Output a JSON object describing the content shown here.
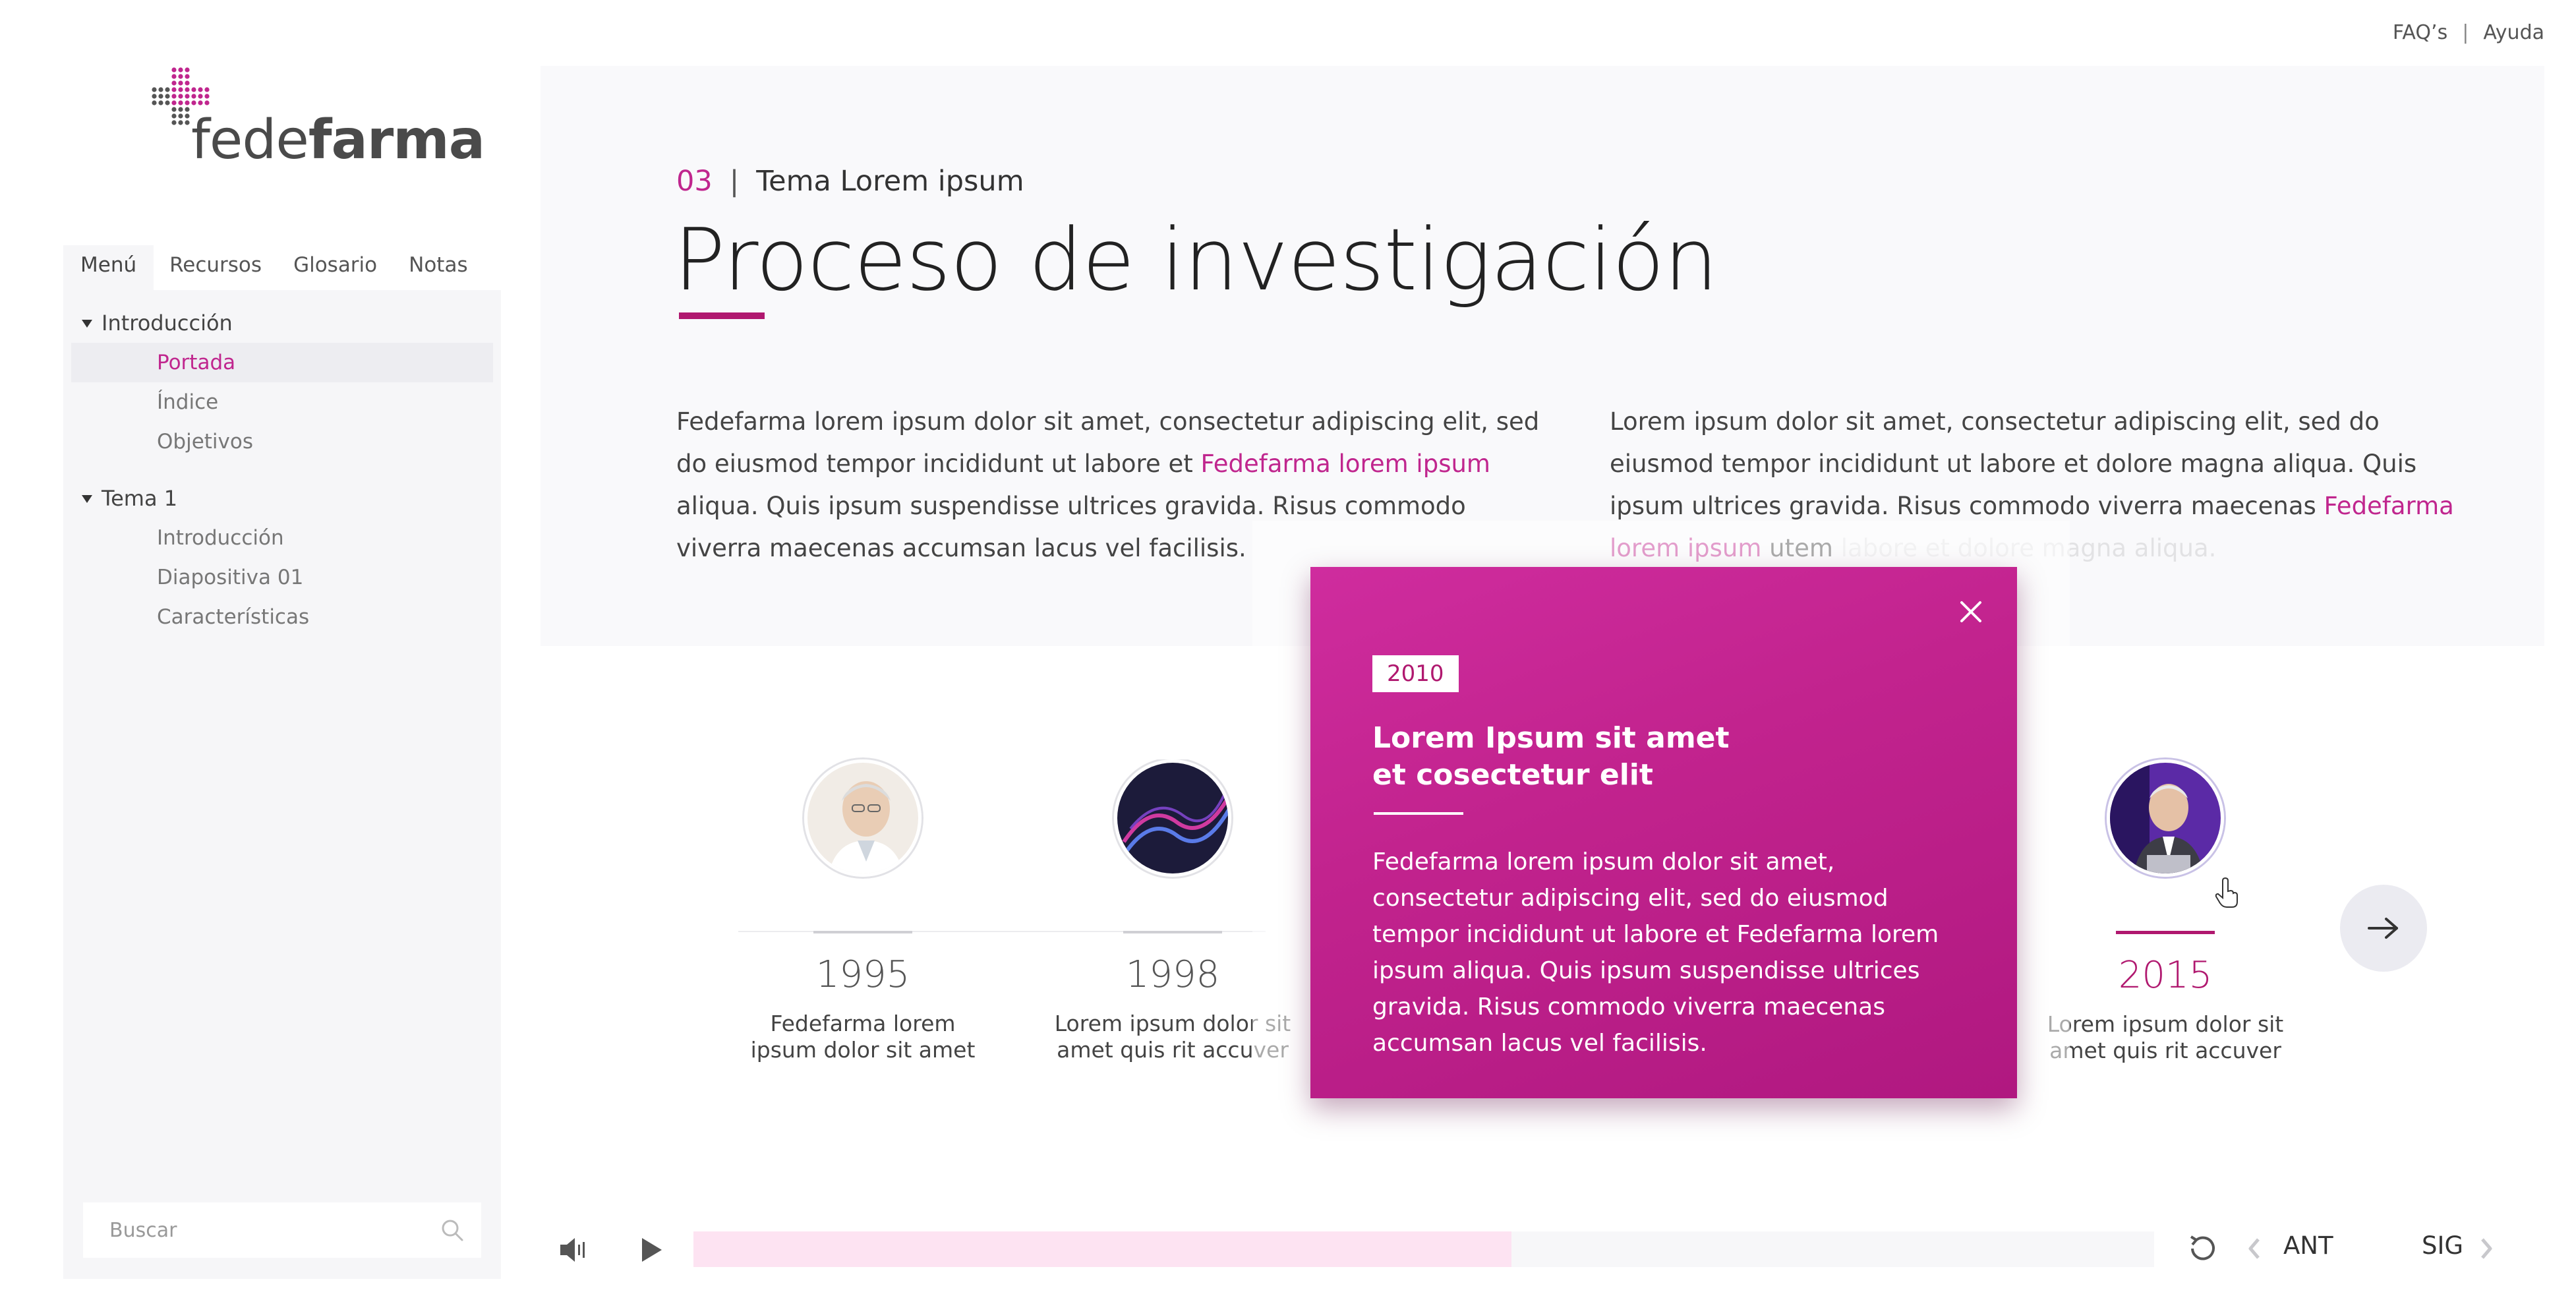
{
  "top_links": {
    "faq": "FAQ’s",
    "separator": "|",
    "help": "Ayuda"
  },
  "logo": {
    "text_light": "fede",
    "text_bold": "farma"
  },
  "sidebar": {
    "tabs": [
      "Menú",
      "Recursos",
      "Glosario",
      "Notas"
    ],
    "active_tab": "Menú",
    "groups": [
      {
        "label": "Introducción",
        "items": [
          {
            "label": "Portada",
            "active": true
          },
          {
            "label": "Índice"
          },
          {
            "label": "Objetivos"
          }
        ]
      },
      {
        "label": "Tema 1",
        "items": [
          {
            "label": "Introducción"
          },
          {
            "label": "Diapositiva 01"
          },
          {
            "label": "Características"
          }
        ]
      }
    ],
    "search_placeholder": "Buscar"
  },
  "header": {
    "topic_number": "03",
    "topic_separator": "|",
    "topic_name": "Tema Lorem ipsum",
    "title": "Proceso de investigación"
  },
  "paragraphs": {
    "left": {
      "part1": "Fedefarma lorem ipsum dolor sit amet, consectetur adipiscing elit, sed do eiusmod tempor incididunt ut labore et ",
      "highlight": "Fedefarma lorem ipsum",
      "part2": " aliqua. Quis ipsum suspendisse ultrices gravida. Risus commodo viverra maecenas accumsan lacus vel facilisis."
    },
    "right": {
      "part1": "Lorem ipsum dolor sit amet, consectetur adipiscing elit, sed do eiusmod tempor incididunt ut labore et dolore magna aliqua. Quis ipsum ultrices gravida. Risus commodo viverra maecenas ",
      "highlight": "Fedefarma lorem ipsum",
      "part2": " utem ",
      "faded": "labore et dolore magna aliqua."
    }
  },
  "timeline": [
    {
      "year": "1995",
      "desc": "Fedefarma lorem ipsum dolor sit amet",
      "avatar": "doctor-portrait"
    },
    {
      "year": "1998",
      "desc": "Lorem ipsum dolor sit amet quis rit accuver",
      "avatar": "dna-helix"
    },
    {
      "year": "2015",
      "desc": "Lorem ipsum dolor sit amet quis rit accuver",
      "avatar": "speaker-portrait",
      "active": true
    }
  ],
  "modal": {
    "badge": "2010",
    "title": "Lorem Ipsum sit amet et cosectetur elit",
    "body": "Fedefarma lorem ipsum dolor sit amet, consectetur adipiscing elit, sed do eiusmod tempor incididunt ut labore et Fedefarma lorem ipsum aliqua. Quis ipsum suspendisse ultrices gravida. Risus commodo viverra maecenas accumsan lacus vel facilisis."
  },
  "player": {
    "progress": 0.56,
    "prev_label": "ANT",
    "next_label": "SIG"
  },
  "colors": {
    "accent": "#c0268e",
    "modal_bg": "#c2238e",
    "progress_fill": "#fde3f2"
  }
}
